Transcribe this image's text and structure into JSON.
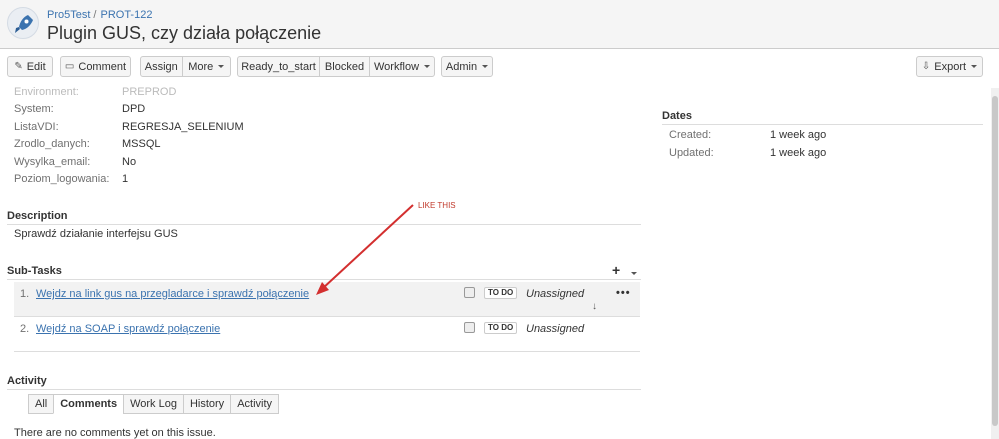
{
  "breadcrumb": {
    "project": "Pro5Test",
    "separator": "/",
    "issue_key": "PROT-122"
  },
  "issue_title": "Plugin GUS, czy działa połączenie",
  "toolbar": {
    "edit": "Edit",
    "comment": "Comment",
    "assign": "Assign",
    "more": "More",
    "ready_to_start": "Ready_to_start",
    "blocked": "Blocked",
    "workflow": "Workflow",
    "admin": "Admin",
    "export": "Export"
  },
  "details": {
    "fields": [
      {
        "label": "Environment:",
        "value": "PREPROD"
      },
      {
        "label": "System:",
        "value": "DPD"
      },
      {
        "label": "ListaVDI:",
        "value": "REGRESJA_SELENIUM"
      },
      {
        "label": "Zrodlo_danych:",
        "value": "MSSQL"
      },
      {
        "label": "Wysylka_email:",
        "value": "No"
      },
      {
        "label": "Poziom_logowania:",
        "value": "1"
      }
    ]
  },
  "dates": {
    "heading": "Dates",
    "created_label": "Created:",
    "created_value": "1 week ago",
    "updated_label": "Updated:",
    "updated_value": "1 week ago"
  },
  "description": {
    "heading": "Description",
    "text": "Sprawdź działanie interfejsu GUS"
  },
  "subtasks": {
    "heading": "Sub-Tasks",
    "items": [
      {
        "num": "1.",
        "title": "Wejdz na link gus na przegladarce i sprawdź połączenie",
        "status": "TO DO",
        "assignee": "Unassigned"
      },
      {
        "num": "2.",
        "title": "Wejdź na SOAP i sprawdź połączenie",
        "status": "TO DO",
        "assignee": "Unassigned"
      }
    ],
    "more_label": "•••"
  },
  "activity": {
    "heading": "Activity",
    "tabs": [
      "All",
      "Comments",
      "Work Log",
      "History",
      "Activity"
    ],
    "active_tab": "Comments",
    "empty_text": "There are no comments yet on this issue."
  },
  "annotation": {
    "text": "LIKE THIS",
    "color": "#d32f2f"
  },
  "colors": {
    "link": "#3b73af",
    "accent": "#3b73af"
  }
}
